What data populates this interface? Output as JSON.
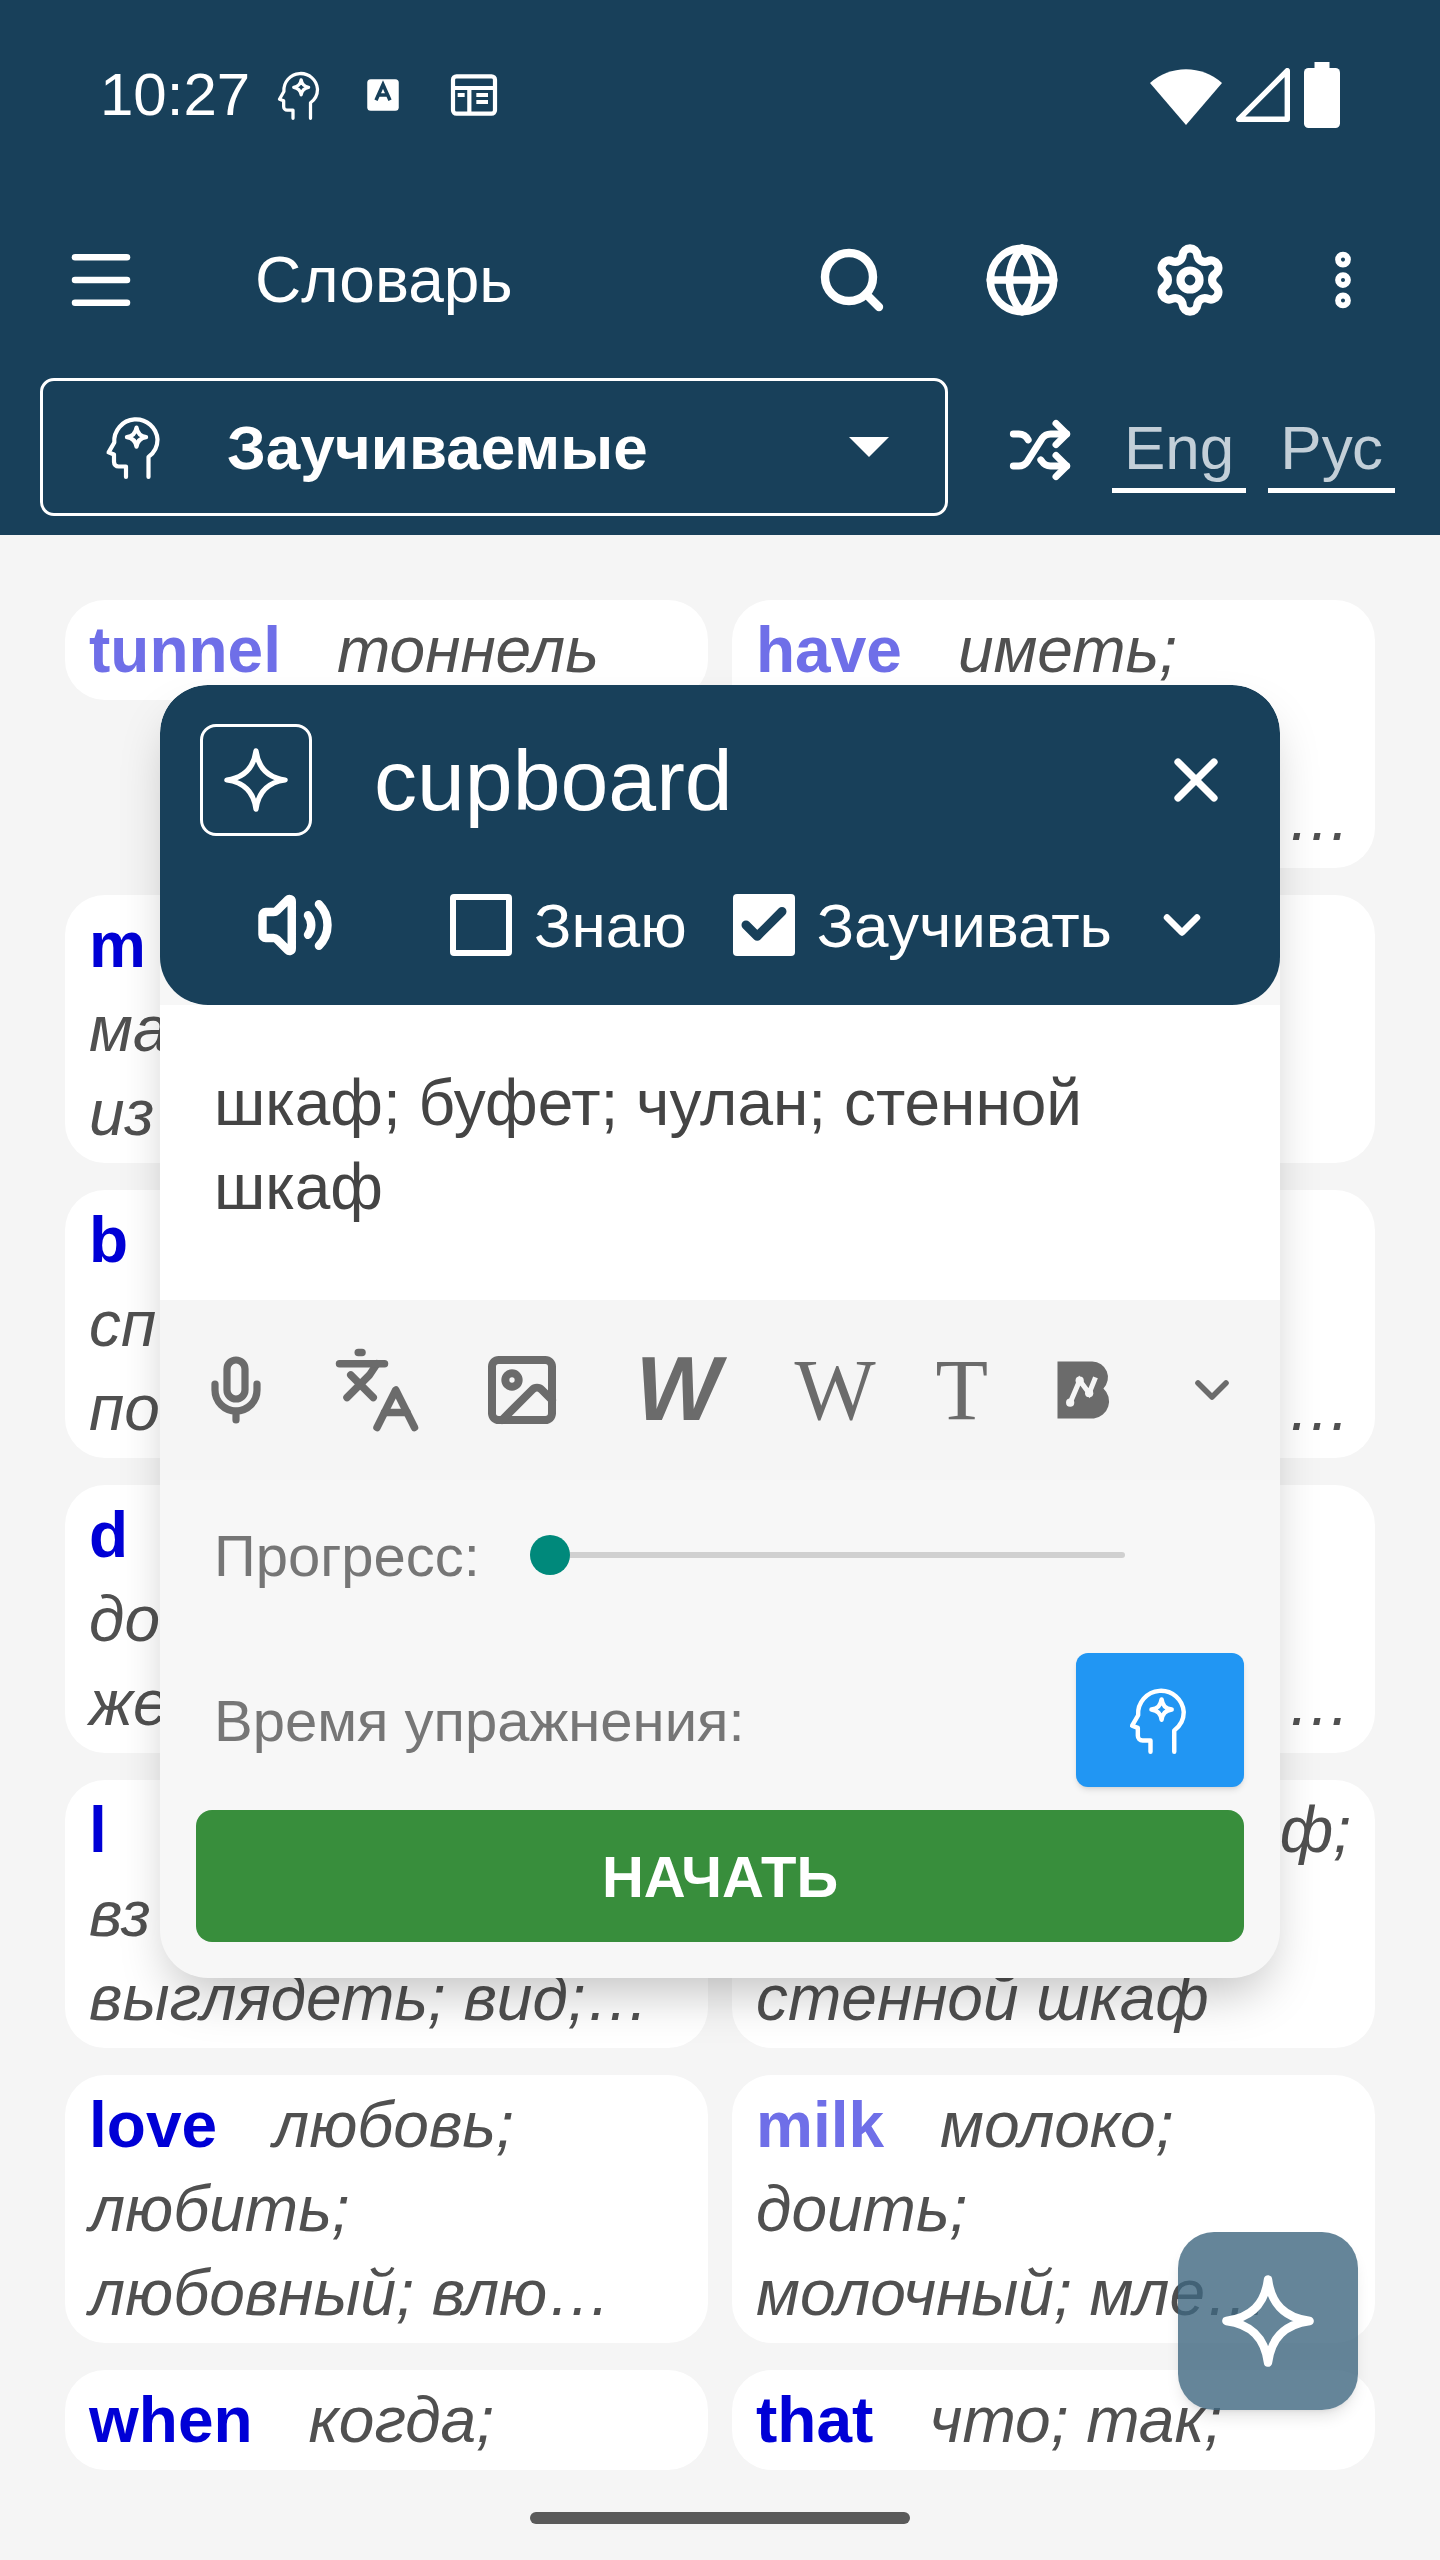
{
  "status_bar": {
    "time": "10:27"
  },
  "app_bar": {
    "title": "Словарь"
  },
  "filter": {
    "value": "Заучиваемые",
    "languages": [
      {
        "label": "Eng"
      },
      {
        "label": "Рус"
      }
    ]
  },
  "cards": [
    {
      "kind": "entry",
      "word": "tunnel",
      "color": "#6f6fe8",
      "first": "тоннель"
    },
    {
      "kind": "entry",
      "word": "have",
      "color": "#6f6fe8",
      "first": "иметь;",
      "tail": "…"
    },
    {
      "kind": "entry",
      "word": "m",
      "color": "#0000d6",
      "rest": [
        "ма",
        "из"
      ]
    },
    {
      "kind": "covered"
    },
    {
      "kind": "entry",
      "word": "b",
      "color": "#0000d6",
      "rest": [
        "сп",
        "по"
      ]
    },
    {
      "kind": "entry",
      "tail": "…"
    },
    {
      "kind": "entry",
      "word": "d",
      "color": "#0000d6",
      "rest": [
        "до",
        "же"
      ]
    },
    {
      "kind": "entry",
      "tail": "…"
    },
    {
      "kind": "entry",
      "word": "l",
      "color": "#0000d6",
      "rest": [
        "вз",
        "выглядеть; вид;…"
      ]
    },
    {
      "kind": "entry",
      "first_right": "ф;",
      "rest": [
        "стенной шкаф"
      ]
    },
    {
      "kind": "entry",
      "word": "love",
      "color": "#0000d6",
      "first": "любовь;",
      "rest": [
        "любить;",
        "любовный; влю…"
      ]
    },
    {
      "kind": "entry",
      "word": "milk",
      "color": "#6f6fe8",
      "first": "молоко;",
      "rest": [
        "доить;",
        "молочный; мле…"
      ]
    },
    {
      "kind": "entry",
      "word": "when",
      "color": "#0000d6",
      "first": "когда;"
    },
    {
      "kind": "entry",
      "word": "that",
      "color": "#0000d6",
      "first": "что; так;"
    }
  ],
  "dialog": {
    "word": "cupboard",
    "options": [
      {
        "label": "Знаю",
        "checked": false
      },
      {
        "label": "Заучивать",
        "checked": true
      }
    ],
    "translation": "шкаф; буфет; чулан; стенной шкаф",
    "tools": [
      {
        "kind": "mic"
      },
      {
        "kind": "translate"
      },
      {
        "kind": "image"
      },
      {
        "kind": "italic-letter",
        "text": "W"
      },
      {
        "kind": "serif-letter",
        "text": "W"
      },
      {
        "kind": "serif-letter",
        "text": "T"
      },
      {
        "kind": "logo"
      },
      {
        "kind": "more"
      }
    ],
    "progress": {
      "label": "Прогресс:",
      "level": 0
    },
    "exercise_time": {
      "label": "Время упражнения:"
    },
    "start_button": "НАЧАТЬ"
  }
}
